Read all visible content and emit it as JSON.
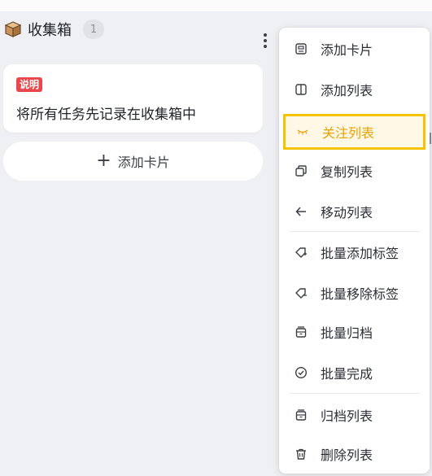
{
  "column": {
    "title": "收集箱",
    "count": "1",
    "card": {
      "tag": "说明",
      "text": "将所有任务先记录在收集箱中"
    },
    "add_card_label": "添加卡片"
  },
  "menu": {
    "items": [
      {
        "label": "添加卡片",
        "icon": "card-icon"
      },
      {
        "label": "添加列表",
        "icon": "columns-icon"
      },
      {
        "label": "关注列表",
        "icon": "eye-closed-icon"
      },
      {
        "label": "复制列表",
        "icon": "copy-icon"
      },
      {
        "label": "移动列表",
        "icon": "arrow-left-icon"
      },
      {
        "label": "批量添加标签",
        "icon": "tag-add-icon"
      },
      {
        "label": "批量移除标签",
        "icon": "tag-remove-icon"
      },
      {
        "label": "批量归档",
        "icon": "archive-icon"
      },
      {
        "label": "批量完成",
        "icon": "check-circle-icon"
      },
      {
        "label": "归档列表",
        "icon": "archive-icon"
      },
      {
        "label": "删除列表",
        "icon": "trash-icon"
      }
    ]
  },
  "colors": {
    "highlight_border": "#f5c400",
    "highlight_text": "#e7a200",
    "tag_bg": "#e9474c"
  }
}
